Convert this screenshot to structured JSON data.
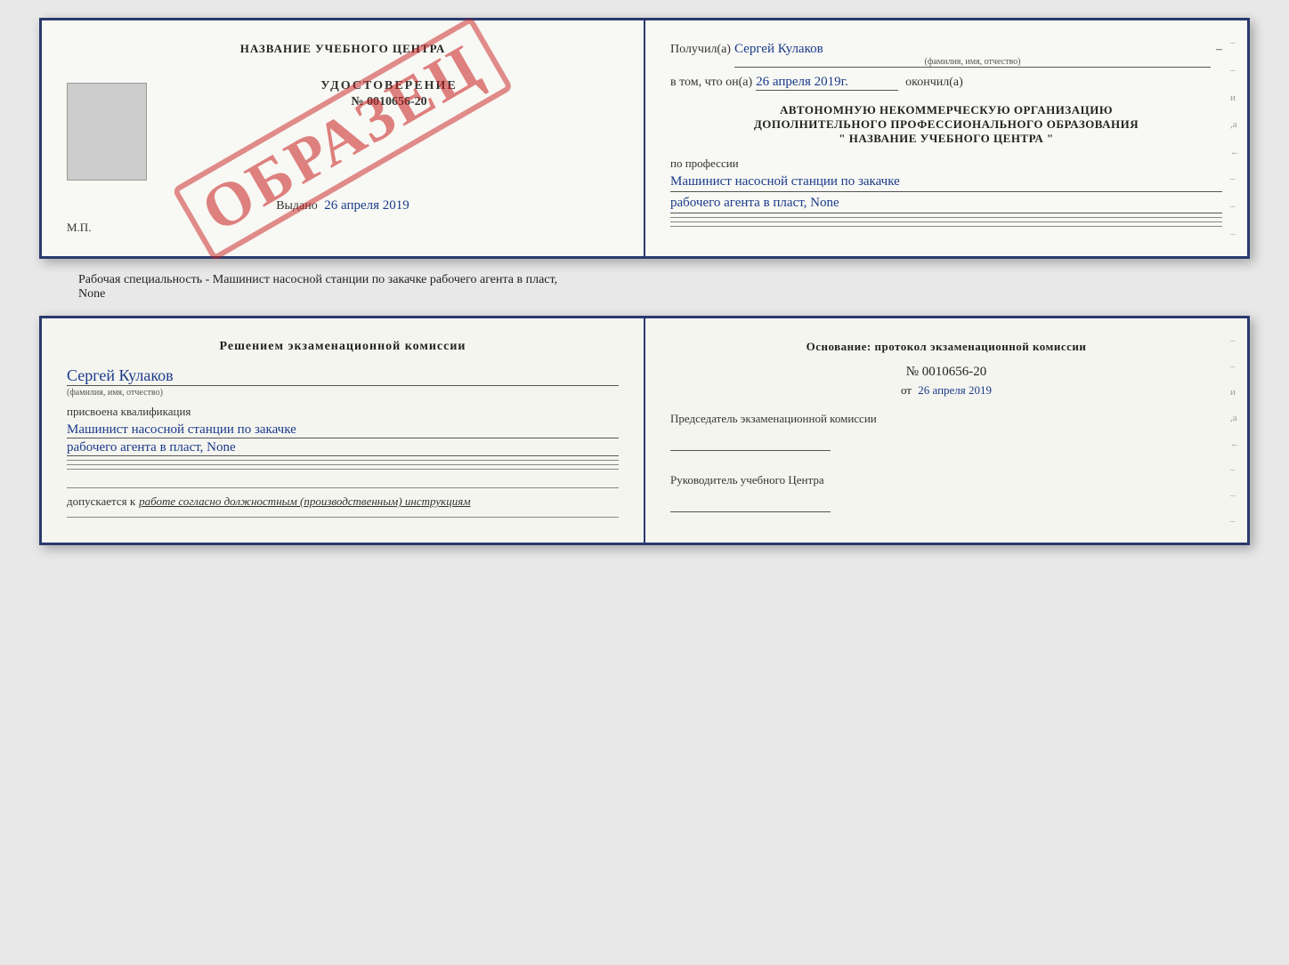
{
  "top_booklet": {
    "left": {
      "center_title": "НАЗВАНИЕ УЧЕБНОГО ЦЕНТРА",
      "udostoverenie_label": "УДОСТОВЕРЕНИЕ",
      "cert_number": "№ 0010656-20",
      "vydano_label": "Выдано",
      "vydano_date": "26 апреля 2019",
      "mp_label": "М.П.",
      "obrazec": "ОБРАЗЕЦ"
    },
    "right": {
      "poluchil_label": "Получил(а)",
      "poluchil_name": "Сергей Кулаков",
      "familiya_label": "(фамилия, имя, отчество)",
      "vtom_label": "в том, что он(а)",
      "date_value": "26 апреля 2019г.",
      "okonchil_label": "окончил(а)",
      "org_line1": "АВТОНОМНУЮ НЕКОММЕРЧЕСКУЮ ОРГАНИЗАЦИЮ",
      "org_line2": "ДОПОЛНИТЕЛЬНОГО ПРОФЕССИОНАЛЬНОГО ОБРАЗОВАНИЯ",
      "org_name": "\" НАЗВАНИЕ УЧЕБНОГО ЦЕНТРА \"",
      "po_professii_label": "по профессии",
      "profession_line1": "Машинист насосной станции по закачке",
      "profession_line2": "рабочего агента в пласт, None"
    }
  },
  "subtitle": "Рабочая специальность - Машинист насосной станции по закачке рабочего агента в пласт,",
  "subtitle2": "None",
  "bottom_booklet": {
    "left": {
      "decision_title": "Решением экзаменационной комиссии",
      "person_name": "Сергей Кулаков",
      "familiya_label": "(фамилия, имя, отчество)",
      "assigned_label": "присвоена квалификация",
      "profession_line1": "Машинист насосной станции по закачке",
      "profession_line2": "рабочего агента в пласт, None",
      "dopuskaetsya_label": "допускается к",
      "dopuskaetsya_value": "работе согласно должностным (производственным) инструкциям"
    },
    "right": {
      "osnov_label": "Основание: протокол экзаменационной комиссии",
      "protocol_number": "№ 0010656-20",
      "ot_label": "от",
      "ot_date": "26 апреля 2019",
      "predsedatel_label": "Председатель экзаменационной комиссии",
      "rukovoditel_label": "Руководитель учебного Центра"
    }
  }
}
